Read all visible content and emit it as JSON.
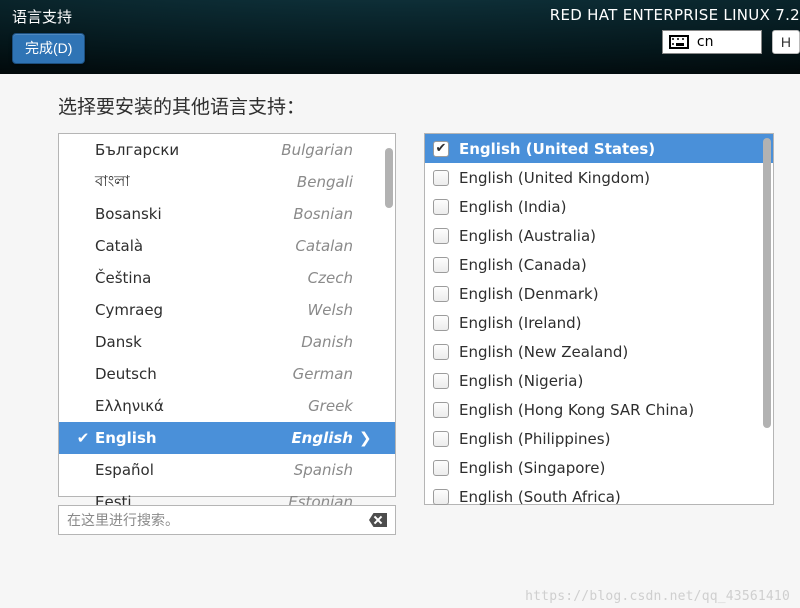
{
  "topbar": {
    "title": "语言支持",
    "done_label": "完成(D)",
    "product": "RED HAT ENTERPRISE LINUX 7.2",
    "keyboard_layout": "cn",
    "help_label": "H"
  },
  "heading": "选择要安装的其他语言支持：",
  "languages": [
    {
      "native": "Български",
      "english": "Bulgarian",
      "selected": false,
      "checked": false
    },
    {
      "native": "বাংলা",
      "english": "Bengali",
      "selected": false,
      "checked": false
    },
    {
      "native": "Bosanski",
      "english": "Bosnian",
      "selected": false,
      "checked": false
    },
    {
      "native": "Català",
      "english": "Catalan",
      "selected": false,
      "checked": false
    },
    {
      "native": "Čeština",
      "english": "Czech",
      "selected": false,
      "checked": false
    },
    {
      "native": "Cymraeg",
      "english": "Welsh",
      "selected": false,
      "checked": false
    },
    {
      "native": "Dansk",
      "english": "Danish",
      "selected": false,
      "checked": false
    },
    {
      "native": "Deutsch",
      "english": "German",
      "selected": false,
      "checked": false
    },
    {
      "native": "Ελληνικά",
      "english": "Greek",
      "selected": false,
      "checked": false
    },
    {
      "native": "English",
      "english": "English",
      "selected": true,
      "checked": true
    },
    {
      "native": "Español",
      "english": "Spanish",
      "selected": false,
      "checked": false
    },
    {
      "native": "Eesti",
      "english": "Estonian",
      "selected": false,
      "checked": false
    }
  ],
  "locales": [
    {
      "label": "English (United States)",
      "checked": true,
      "selected": true
    },
    {
      "label": "English (United Kingdom)",
      "checked": false,
      "selected": false
    },
    {
      "label": "English (India)",
      "checked": false,
      "selected": false
    },
    {
      "label": "English (Australia)",
      "checked": false,
      "selected": false
    },
    {
      "label": "English (Canada)",
      "checked": false,
      "selected": false
    },
    {
      "label": "English (Denmark)",
      "checked": false,
      "selected": false
    },
    {
      "label": "English (Ireland)",
      "checked": false,
      "selected": false
    },
    {
      "label": "English (New Zealand)",
      "checked": false,
      "selected": false
    },
    {
      "label": "English (Nigeria)",
      "checked": false,
      "selected": false
    },
    {
      "label": "English (Hong Kong SAR China)",
      "checked": false,
      "selected": false
    },
    {
      "label": "English (Philippines)",
      "checked": false,
      "selected": false
    },
    {
      "label": "English (Singapore)",
      "checked": false,
      "selected": false
    },
    {
      "label": "English (South Africa)",
      "checked": false,
      "selected": false
    }
  ],
  "search": {
    "placeholder": "在这里进行搜索。"
  },
  "watermark": "https://blog.csdn.net/qq_43561410"
}
